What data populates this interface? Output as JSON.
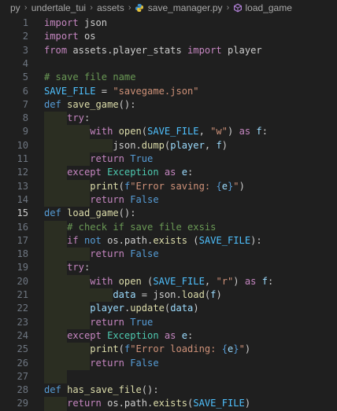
{
  "breadcrumb": {
    "items": [
      "py",
      "undertale_tui",
      "assets",
      "save_manager.py",
      "load_game"
    ],
    "file_icon": "python-file-icon",
    "symbol_icon": "function-symbol-icon"
  },
  "editor": {
    "active_line": 15,
    "lines": [
      {
        "n": "1",
        "tokens": [
          [
            "kw",
            "import"
          ],
          [
            "pl",
            " "
          ],
          [
            "pl",
            "json"
          ]
        ]
      },
      {
        "n": "2",
        "tokens": [
          [
            "kw",
            "import"
          ],
          [
            "pl",
            " "
          ],
          [
            "pl",
            "os"
          ]
        ]
      },
      {
        "n": "3",
        "tokens": [
          [
            "kw",
            "from"
          ],
          [
            "pl",
            " assets.player_stats "
          ],
          [
            "kw",
            "import"
          ],
          [
            "pl",
            " player"
          ]
        ]
      },
      {
        "n": "4",
        "tokens": []
      },
      {
        "n": "5",
        "tokens": [
          [
            "cmt",
            "# save file name"
          ]
        ]
      },
      {
        "n": "6",
        "tokens": [
          [
            "cst",
            "SAVE_FILE"
          ],
          [
            "pl",
            " = "
          ],
          [
            "str",
            "\"savegame.json\""
          ]
        ]
      },
      {
        "n": "7",
        "tokens": [
          [
            "kw2",
            "def"
          ],
          [
            "pl",
            " "
          ],
          [
            "fn",
            "save_game"
          ],
          [
            "pl",
            "():"
          ]
        ]
      },
      {
        "n": "8",
        "tokens": [
          [
            "pl",
            "    "
          ],
          [
            "kw",
            "try"
          ],
          [
            "pl",
            ":"
          ]
        ]
      },
      {
        "n": "9",
        "tokens": [
          [
            "pl",
            "        "
          ],
          [
            "kw",
            "with"
          ],
          [
            "pl",
            " "
          ],
          [
            "fn",
            "open"
          ],
          [
            "pl",
            "("
          ],
          [
            "cst",
            "SAVE_FILE"
          ],
          [
            "pl",
            ", "
          ],
          [
            "str",
            "\"w\""
          ],
          [
            "pl",
            ") "
          ],
          [
            "kw",
            "as"
          ],
          [
            "pl",
            " "
          ],
          [
            "var",
            "f"
          ],
          [
            "pl",
            ":"
          ]
        ]
      },
      {
        "n": "10",
        "tokens": [
          [
            "pl",
            "            "
          ],
          [
            "pl",
            "json."
          ],
          [
            "fn",
            "dump"
          ],
          [
            "pl",
            "("
          ],
          [
            "var",
            "player"
          ],
          [
            "pl",
            ", "
          ],
          [
            "var",
            "f"
          ],
          [
            "pl",
            ")"
          ]
        ]
      },
      {
        "n": "11",
        "tokens": [
          [
            "pl",
            "        "
          ],
          [
            "kw",
            "return"
          ],
          [
            "pl",
            " "
          ],
          [
            "bool",
            "True"
          ]
        ]
      },
      {
        "n": "12",
        "tokens": [
          [
            "pl",
            "    "
          ],
          [
            "kw",
            "except"
          ],
          [
            "pl",
            " "
          ],
          [
            "cls",
            "Exception"
          ],
          [
            "pl",
            " "
          ],
          [
            "kw",
            "as"
          ],
          [
            "pl",
            " "
          ],
          [
            "var",
            "e"
          ],
          [
            "pl",
            ":"
          ]
        ]
      },
      {
        "n": "13",
        "tokens": [
          [
            "pl",
            "        "
          ],
          [
            "fn",
            "print"
          ],
          [
            "pl",
            "("
          ],
          [
            "kw2",
            "f"
          ],
          [
            "str",
            "\"Error saving: "
          ],
          [
            "kw2",
            "{"
          ],
          [
            "var",
            "e"
          ],
          [
            "kw2",
            "}"
          ],
          [
            "str",
            "\""
          ],
          [
            "pl",
            ")"
          ]
        ]
      },
      {
        "n": "14",
        "tokens": [
          [
            "pl",
            "        "
          ],
          [
            "kw",
            "return"
          ],
          [
            "pl",
            " "
          ],
          [
            "bool",
            "False"
          ]
        ]
      },
      {
        "n": "15",
        "tokens": [
          [
            "kw2",
            "def"
          ],
          [
            "pl",
            " "
          ],
          [
            "fn",
            "load_game"
          ],
          [
            "pl",
            "():"
          ]
        ]
      },
      {
        "n": "16",
        "tokens": [
          [
            "pl",
            "    "
          ],
          [
            "cmt",
            "# check if save file exsis"
          ]
        ]
      },
      {
        "n": "17",
        "tokens": [
          [
            "pl",
            "    "
          ],
          [
            "kw",
            "if"
          ],
          [
            "pl",
            " "
          ],
          [
            "kw2",
            "not"
          ],
          [
            "pl",
            " os.path."
          ],
          [
            "fn",
            "exists"
          ],
          [
            "pl",
            " ("
          ],
          [
            "cst",
            "SAVE_FILE"
          ],
          [
            "pl",
            "):"
          ]
        ]
      },
      {
        "n": "18",
        "tokens": [
          [
            "pl",
            "        "
          ],
          [
            "kw",
            "return"
          ],
          [
            "pl",
            " "
          ],
          [
            "bool",
            "False"
          ]
        ]
      },
      {
        "n": "19",
        "tokens": [
          [
            "pl",
            "    "
          ],
          [
            "kw",
            "try"
          ],
          [
            "pl",
            ":"
          ]
        ]
      },
      {
        "n": "20",
        "tokens": [
          [
            "pl",
            "        "
          ],
          [
            "kw",
            "with"
          ],
          [
            "pl",
            " "
          ],
          [
            "fn",
            "open"
          ],
          [
            "pl",
            " ("
          ],
          [
            "cst",
            "SAVE_FILE"
          ],
          [
            "pl",
            ", "
          ],
          [
            "str",
            "\"r\""
          ],
          [
            "pl",
            ") "
          ],
          [
            "kw",
            "as"
          ],
          [
            "pl",
            " "
          ],
          [
            "var",
            "f"
          ],
          [
            "pl",
            ":"
          ]
        ]
      },
      {
        "n": "21",
        "tokens": [
          [
            "pl",
            "            "
          ],
          [
            "var",
            "data"
          ],
          [
            "pl",
            " = json."
          ],
          [
            "fn",
            "load"
          ],
          [
            "pl",
            "("
          ],
          [
            "var",
            "f"
          ],
          [
            "pl",
            ")"
          ]
        ]
      },
      {
        "n": "22",
        "tokens": [
          [
            "pl",
            "        "
          ],
          [
            "var",
            "player"
          ],
          [
            "pl",
            "."
          ],
          [
            "fn",
            "update"
          ],
          [
            "pl",
            "("
          ],
          [
            "var",
            "data"
          ],
          [
            "pl",
            ")"
          ]
        ]
      },
      {
        "n": "23",
        "tokens": [
          [
            "pl",
            "        "
          ],
          [
            "kw",
            "return"
          ],
          [
            "pl",
            " "
          ],
          [
            "bool",
            "True"
          ]
        ]
      },
      {
        "n": "24",
        "tokens": [
          [
            "pl",
            "    "
          ],
          [
            "kw",
            "except"
          ],
          [
            "pl",
            " "
          ],
          [
            "cls",
            "Exception"
          ],
          [
            "pl",
            " "
          ],
          [
            "kw",
            "as"
          ],
          [
            "pl",
            " "
          ],
          [
            "var",
            "e"
          ],
          [
            "pl",
            ":"
          ]
        ]
      },
      {
        "n": "25",
        "tokens": [
          [
            "pl",
            "        "
          ],
          [
            "fn",
            "print"
          ],
          [
            "pl",
            "("
          ],
          [
            "kw2",
            "f"
          ],
          [
            "str",
            "\"Error loading: "
          ],
          [
            "kw2",
            "{"
          ],
          [
            "var",
            "e"
          ],
          [
            "kw2",
            "}"
          ],
          [
            "str",
            "\""
          ],
          [
            "pl",
            ")"
          ]
        ]
      },
      {
        "n": "26",
        "tokens": [
          [
            "pl",
            "        "
          ],
          [
            "kw",
            "return"
          ],
          [
            "pl",
            " "
          ],
          [
            "bool",
            "False"
          ]
        ]
      },
      {
        "n": "27",
        "tokens": []
      },
      {
        "n": "28",
        "tokens": [
          [
            "kw2",
            "def"
          ],
          [
            "pl",
            " "
          ],
          [
            "fn",
            "has_save_file"
          ],
          [
            "pl",
            "():"
          ]
        ]
      },
      {
        "n": "29",
        "tokens": [
          [
            "pl",
            "    "
          ],
          [
            "kw",
            "return"
          ],
          [
            "pl",
            " os.path."
          ],
          [
            "fn",
            "exists"
          ],
          [
            "pl",
            "("
          ],
          [
            "cst",
            "SAVE_FILE"
          ],
          [
            "pl",
            ")"
          ]
        ]
      }
    ]
  }
}
